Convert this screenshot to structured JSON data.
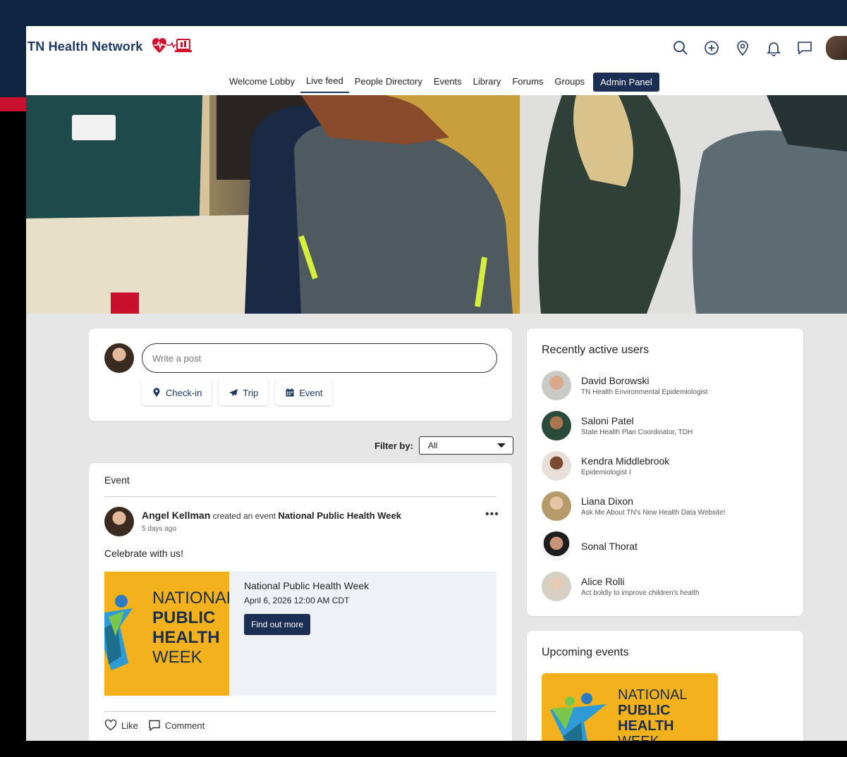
{
  "brand": {
    "name": "TN Health Network"
  },
  "header": {
    "icons": [
      "search-icon",
      "add-circle-icon",
      "location-pin-icon",
      "bell-icon",
      "chat-icon"
    ]
  },
  "nav": {
    "items": [
      {
        "label": "Welcome Lobby",
        "active": false
      },
      {
        "label": "Live feed",
        "active": true
      },
      {
        "label": "People Directory",
        "active": false
      },
      {
        "label": "Events",
        "active": false
      },
      {
        "label": "Library",
        "active": false
      },
      {
        "label": "Forums",
        "active": false
      },
      {
        "label": "Groups",
        "active": false
      }
    ],
    "admin": "Admin Panel"
  },
  "composer": {
    "placeholder": "Write a post",
    "actions": {
      "checkin": "Check-in",
      "trip": "Trip",
      "event": "Event"
    }
  },
  "filter": {
    "label": "Filter by:",
    "value": "All"
  },
  "feed": {
    "type": "Event",
    "author": "Angel Kellman",
    "verb": "created an event",
    "event_name": "National Public Health Week",
    "time": "5 days ago",
    "more": "•••",
    "text": "Celebrate with us!",
    "event": {
      "title": "National Public Health Week",
      "date": "April 6, 2026 12:00 AM CDT",
      "cta": "Find out more",
      "image_lines": [
        "NATIONAL",
        "PUBLIC",
        "HEALTH",
        "WEEK"
      ]
    },
    "like": "Like",
    "comment": "Comment"
  },
  "active_users": {
    "title": "Recently active users",
    "users": [
      {
        "name": "David Borowski",
        "subtitle": "TN Health Environmental Epidemiologist"
      },
      {
        "name": "Saloni Patel",
        "subtitle": "State Health Plan Coordinator, TDH"
      },
      {
        "name": "Kendra Middlebrook",
        "subtitle": "Epidemiologist I"
      },
      {
        "name": "Liana Dixon",
        "subtitle": "Ask Me About TN's New Health Data Website!"
      },
      {
        "name": "Sonal Thorat",
        "subtitle": ""
      },
      {
        "name": "Alice Rolli",
        "subtitle": "Act boldly to improve children's health"
      }
    ]
  },
  "upcoming": {
    "title": "Upcoming events",
    "image_lines": [
      "NATIONAL",
      "PUBLIC",
      "HEALTH",
      "WEEK"
    ]
  },
  "colors": {
    "brand_navy": "#1f3864",
    "button_navy": "#1b2f55",
    "event_yellow": "#f3b21b",
    "logo_red": "#d0112b"
  }
}
